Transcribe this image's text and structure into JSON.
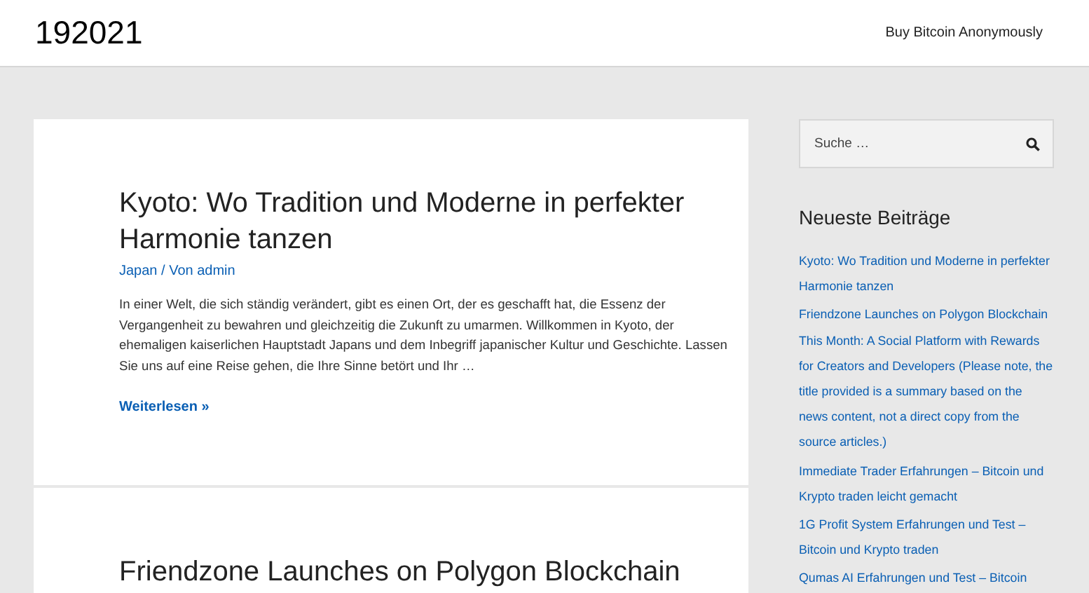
{
  "site_title": "192021",
  "nav": [
    {
      "label": "Buy Bitcoin Anonymously"
    }
  ],
  "posts": [
    {
      "title": "Kyoto: Wo Tradition und Moderne in perfekter Harmonie tanzen",
      "meta": "Japan / Von admin",
      "excerpt": "In einer Welt, die sich ständig verändert, gibt es einen Ort, der es geschafft hat, die Essenz der Vergangenheit zu bewahren und gleichzeitig die Zukunft zu umarmen. Willkommen in Kyoto, der ehemaligen kaiserlichen Hauptstadt Japans und dem Inbegriff japanischer Kultur und Geschichte. Lassen Sie uns auf eine Reise gehen, die Ihre Sinne betört und Ihr …",
      "read_more": "Weiterlesen »"
    },
    {
      "title": "Friendzone Launches on Polygon Blockchain"
    }
  ],
  "sidebar": {
    "search": {
      "placeholder": "Suche …"
    },
    "recent_heading": "Neueste Beiträge",
    "recent_posts": [
      "Kyoto: Wo Tradition und Moderne in perfekter Harmonie tanzen",
      "Friendzone Launches on Polygon Blockchain This Month: A Social Platform with Rewards for Creators and Developers (Please note, the title provided is a summary based on the news content, not a direct copy from the source articles.)",
      "Immediate Trader Erfahrungen – Bitcoin und Krypto traden leicht gemacht",
      "1G Profit System Erfahrungen und Test – Bitcoin und Krypto traden",
      "Qumas AI Erfahrungen und Test – Bitcoin"
    ]
  }
}
